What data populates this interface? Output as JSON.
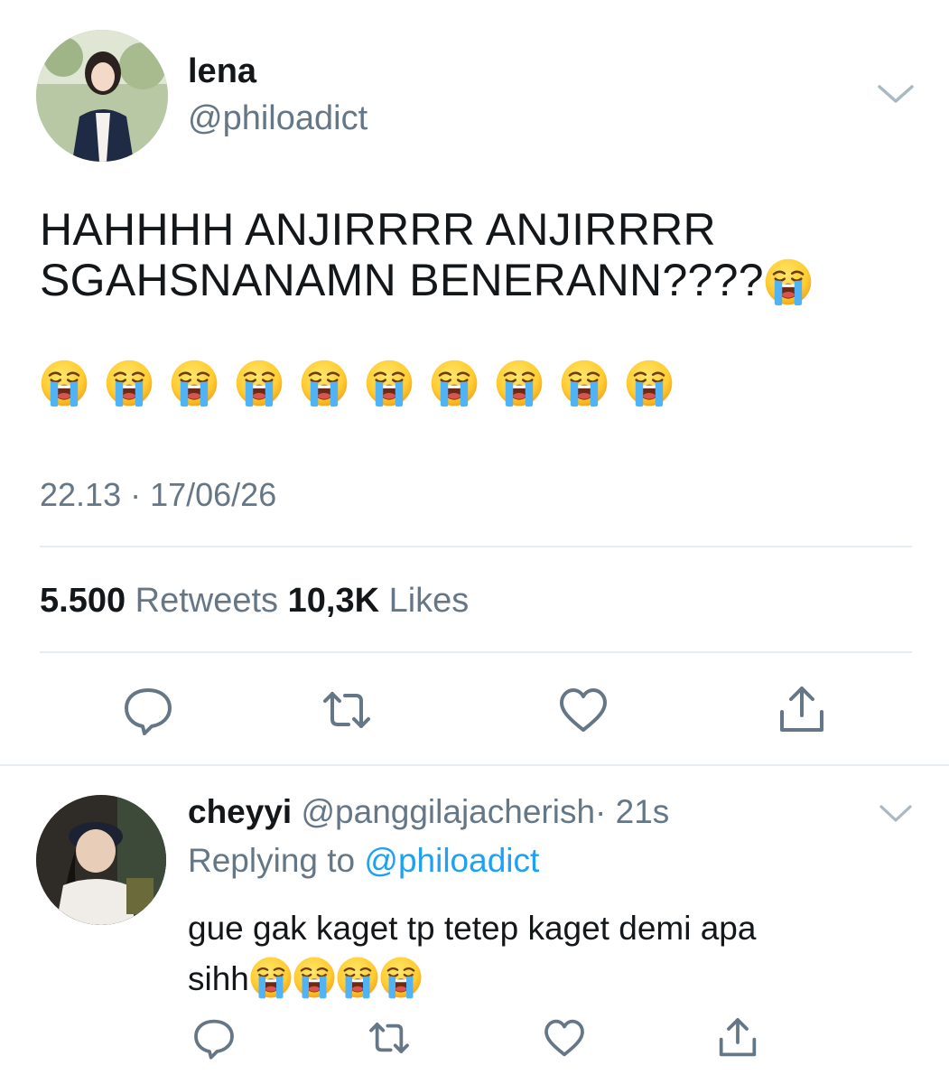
{
  "tweet": {
    "author_name": "lena",
    "author_handle": "@philoadict",
    "text_line1": "HAHHHH ANJIRRRR ANJIRRRR",
    "text_line2": "SGAHSNANAMN BENERANN????",
    "emoji": "loudly-crying-face",
    "emoji_row_count": 10,
    "timestamp": "22.13 · 17/06/26",
    "retweets_count": "5.500",
    "retweets_label": "Retweets",
    "likes_count": "10,3K",
    "likes_label": "Likes"
  },
  "reply": {
    "author_name": "cheyyi",
    "author_handle": "@panggilajacherish",
    "time": "· 21s",
    "replying_prefix": "Replying to",
    "replying_handle": "@philoadict",
    "text_line1": "gue gak kaget tp tetep kaget demi apa",
    "text_line2": "sihh",
    "emoji_count": 4
  },
  "actions": [
    "reply-icon",
    "retweet-icon",
    "like-icon",
    "share-icon"
  ],
  "colors": {
    "text": "#14171a",
    "secondary": "#657786",
    "link": "#1da1f2",
    "divider": "#e6ecf0",
    "icon": "#657786"
  }
}
